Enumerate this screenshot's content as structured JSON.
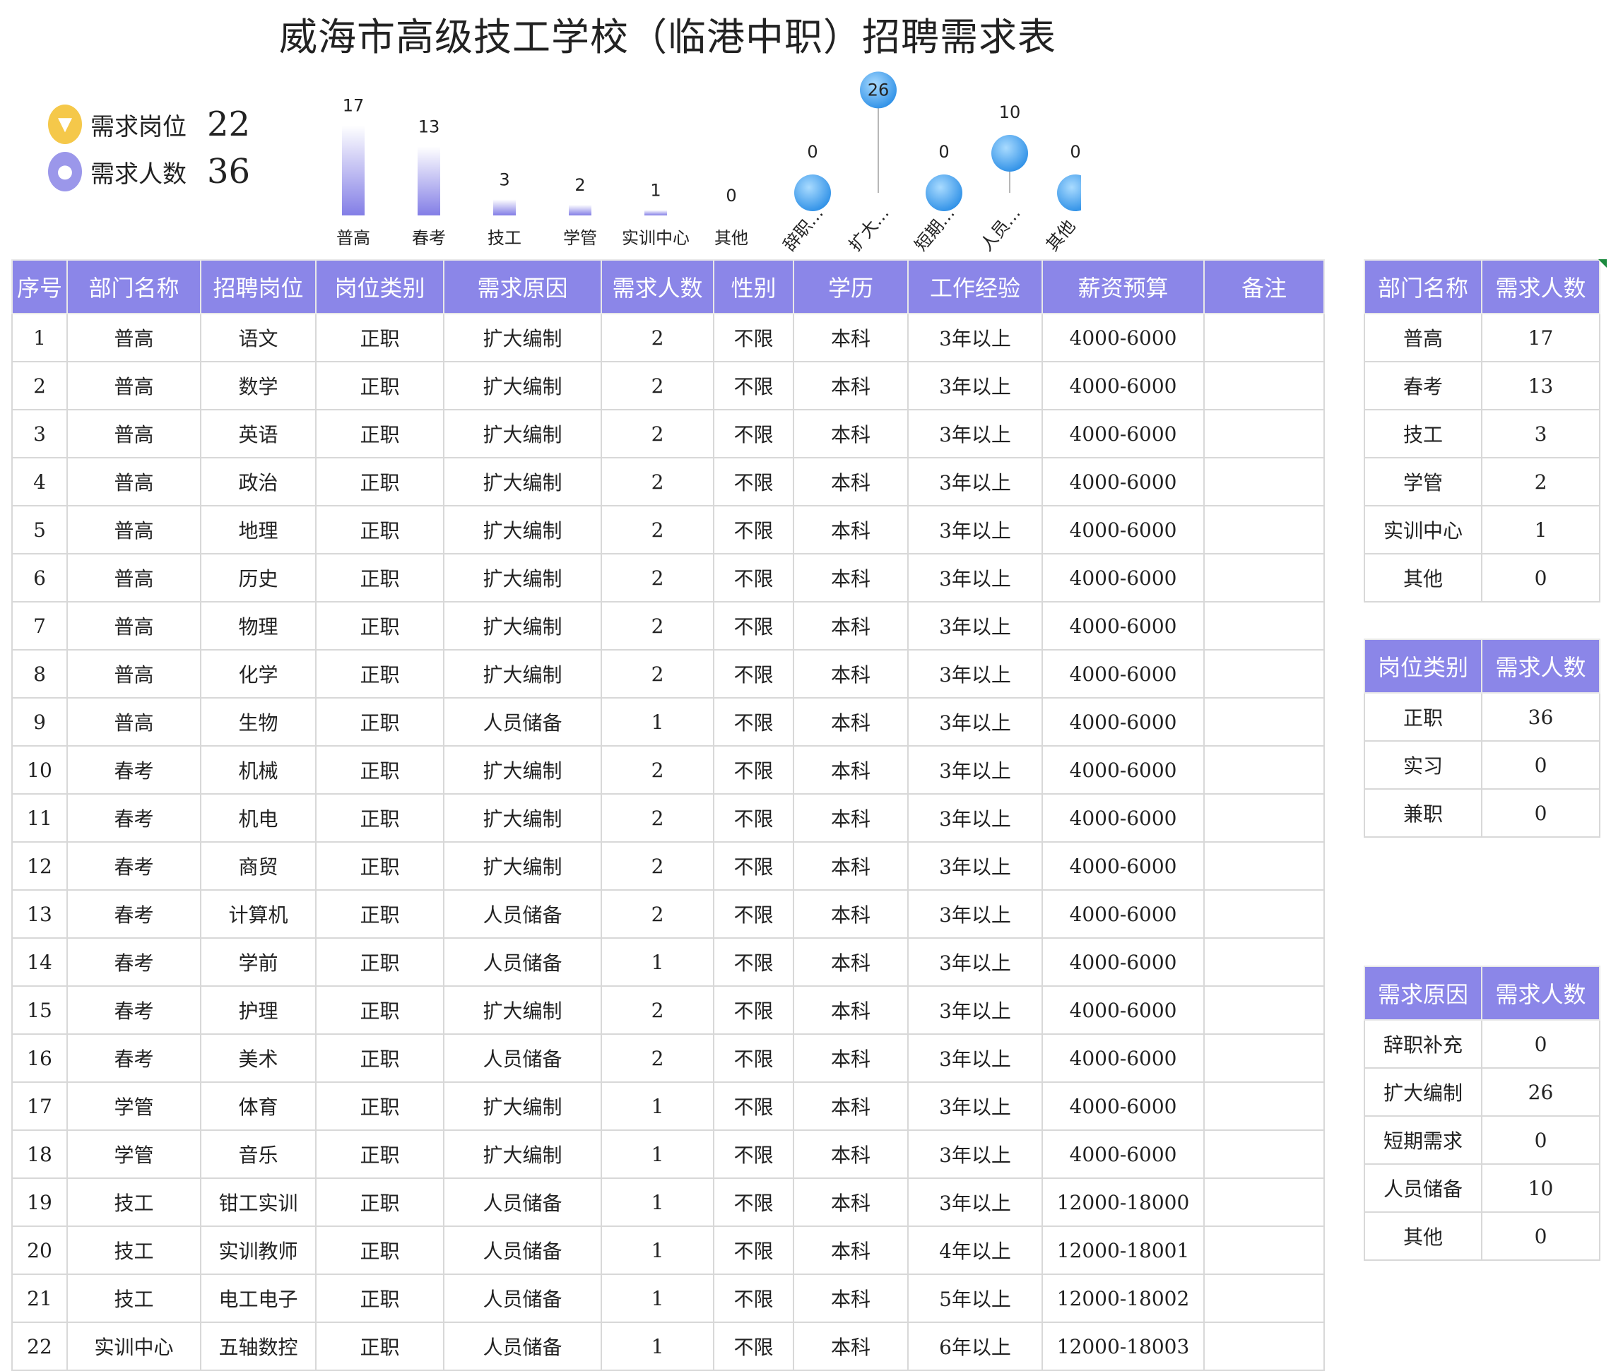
{
  "title": "威海市高级技工学校（临港中职）招聘需求表",
  "kpi": [
    {
      "label": "需求岗位",
      "value": "22",
      "color": "#f5c84a",
      "icon": "tie-icon"
    },
    {
      "label": "需求人数",
      "value": "36",
      "color": "#9b97ea",
      "icon": "person-icon"
    }
  ],
  "chart_data": [
    {
      "type": "bar",
      "categories": [
        "普高",
        "春考",
        "技工",
        "学管",
        "实训中心",
        "其他"
      ],
      "values": [
        17,
        13,
        3,
        2,
        1,
        0
      ]
    },
    {
      "type": "scatter",
      "categories": [
        "辞职…",
        "扩大…",
        "短期…",
        "人员…",
        "其他"
      ],
      "values": [
        0,
        26,
        0,
        10,
        0
      ]
    }
  ],
  "main_table": {
    "headers": [
      "序号",
      "部门名称",
      "招聘岗位",
      "岗位类别",
      "需求原因",
      "需求人数",
      "性别",
      "学历",
      "工作经验",
      "薪资预算",
      "备注"
    ],
    "rows": [
      [
        "1",
        "普高",
        "语文",
        "正职",
        "扩大编制",
        "2",
        "不限",
        "本科",
        "3年以上",
        "4000-6000",
        ""
      ],
      [
        "2",
        "普高",
        "数学",
        "正职",
        "扩大编制",
        "2",
        "不限",
        "本科",
        "3年以上",
        "4000-6000",
        ""
      ],
      [
        "3",
        "普高",
        "英语",
        "正职",
        "扩大编制",
        "2",
        "不限",
        "本科",
        "3年以上",
        "4000-6000",
        ""
      ],
      [
        "4",
        "普高",
        "政治",
        "正职",
        "扩大编制",
        "2",
        "不限",
        "本科",
        "3年以上",
        "4000-6000",
        ""
      ],
      [
        "5",
        "普高",
        "地理",
        "正职",
        "扩大编制",
        "2",
        "不限",
        "本科",
        "3年以上",
        "4000-6000",
        ""
      ],
      [
        "6",
        "普高",
        "历史",
        "正职",
        "扩大编制",
        "2",
        "不限",
        "本科",
        "3年以上",
        "4000-6000",
        ""
      ],
      [
        "7",
        "普高",
        "物理",
        "正职",
        "扩大编制",
        "2",
        "不限",
        "本科",
        "3年以上",
        "4000-6000",
        ""
      ],
      [
        "8",
        "普高",
        "化学",
        "正职",
        "扩大编制",
        "2",
        "不限",
        "本科",
        "3年以上",
        "4000-6000",
        ""
      ],
      [
        "9",
        "普高",
        "生物",
        "正职",
        "人员储备",
        "1",
        "不限",
        "本科",
        "3年以上",
        "4000-6000",
        ""
      ],
      [
        "10",
        "春考",
        "机械",
        "正职",
        "扩大编制",
        "2",
        "不限",
        "本科",
        "3年以上",
        "4000-6000",
        ""
      ],
      [
        "11",
        "春考",
        "机电",
        "正职",
        "扩大编制",
        "2",
        "不限",
        "本科",
        "3年以上",
        "4000-6000",
        ""
      ],
      [
        "12",
        "春考",
        "商贸",
        "正职",
        "扩大编制",
        "2",
        "不限",
        "本科",
        "3年以上",
        "4000-6000",
        ""
      ],
      [
        "13",
        "春考",
        "计算机",
        "正职",
        "人员储备",
        "2",
        "不限",
        "本科",
        "3年以上",
        "4000-6000",
        ""
      ],
      [
        "14",
        "春考",
        "学前",
        "正职",
        "人员储备",
        "1",
        "不限",
        "本科",
        "3年以上",
        "4000-6000",
        ""
      ],
      [
        "15",
        "春考",
        "护理",
        "正职",
        "扩大编制",
        "2",
        "不限",
        "本科",
        "3年以上",
        "4000-6000",
        ""
      ],
      [
        "16",
        "春考",
        "美术",
        "正职",
        "人员储备",
        "2",
        "不限",
        "本科",
        "3年以上",
        "4000-6000",
        ""
      ],
      [
        "17",
        "学管",
        "体育",
        "正职",
        "扩大编制",
        "1",
        "不限",
        "本科",
        "3年以上",
        "4000-6000",
        ""
      ],
      [
        "18",
        "学管",
        "音乐",
        "正职",
        "扩大编制",
        "1",
        "不限",
        "本科",
        "3年以上",
        "4000-6000",
        ""
      ],
      [
        "19",
        "技工",
        "钳工实训",
        "正职",
        "人员储备",
        "1",
        "不限",
        "本科",
        "3年以上",
        "12000-18000",
        ""
      ],
      [
        "20",
        "技工",
        "实训教师",
        "正职",
        "人员储备",
        "1",
        "不限",
        "本科",
        "4年以上",
        "12000-18001",
        ""
      ],
      [
        "21",
        "技工",
        "电工电子",
        "正职",
        "人员储备",
        "1",
        "不限",
        "本科",
        "5年以上",
        "12000-18002",
        ""
      ],
      [
        "22",
        "实训中心",
        "五轴数控",
        "正职",
        "人员储备",
        "1",
        "不限",
        "本科",
        "6年以上",
        "12000-18003",
        ""
      ]
    ]
  },
  "side_tables": [
    {
      "headers": [
        "部门名称",
        "需求人数"
      ],
      "rows": [
        [
          "普高",
          "17"
        ],
        [
          "春考",
          "13"
        ],
        [
          "技工",
          "3"
        ],
        [
          "学管",
          "2"
        ],
        [
          "实训中心",
          "1"
        ],
        [
          "其他",
          "0"
        ]
      ]
    },
    {
      "headers": [
        "岗位类别",
        "需求人数"
      ],
      "rows": [
        [
          "正职",
          "36"
        ],
        [
          "实习",
          "0"
        ],
        [
          "兼职",
          "0"
        ]
      ]
    },
    {
      "headers": [
        "需求原因",
        "需求人数"
      ],
      "rows": [
        [
          "辞职补充",
          "0"
        ],
        [
          "扩大编制",
          "26"
        ],
        [
          "短期需求",
          "0"
        ],
        [
          "人员储备",
          "10"
        ],
        [
          "其他",
          "0"
        ]
      ]
    }
  ]
}
